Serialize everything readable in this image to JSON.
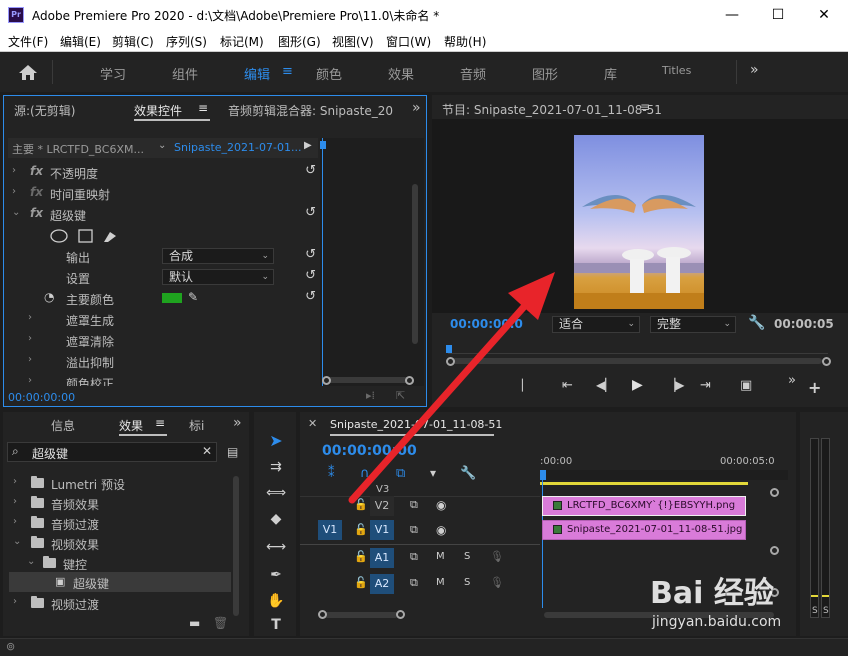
{
  "window": {
    "logo": "Pr",
    "title": "Adobe Premiere Pro 2020 - d:\\文档\\Adobe\\Premiere Pro\\11.0\\未命名 *",
    "minimize": "—",
    "maximize": "☐",
    "close": "✕"
  },
  "menu": [
    "文件(F)",
    "编辑(E)",
    "剪辑(C)",
    "序列(S)",
    "标记(M)",
    "图形(G)",
    "视图(V)",
    "窗口(W)",
    "帮助(H)"
  ],
  "workspaces": {
    "items": [
      "学习",
      "组件",
      "编辑",
      "颜色",
      "效果",
      "音频",
      "图形",
      "库",
      "Titles"
    ],
    "active": "编辑",
    "more": "»"
  },
  "effect_controls": {
    "tabs": [
      "源:(无剪辑)",
      "效果控件",
      "音频剪辑混合器: Snipaste_20"
    ],
    "more": "»",
    "master": "主要 * LRCTFD_BC6XM...",
    "clip": "Snipaste_2021-07-01...",
    "rows": {
      "opacity": "不透明度",
      "time_remap": "时间重映射",
      "ultra_key": "超级键",
      "output": "输出",
      "output_value": "合成",
      "setting": "设置",
      "setting_value": "默认",
      "key_color": "主要颜色",
      "matte_gen": "遮罩生成",
      "matte_clean": "遮罩清除",
      "spill": "溢出抑制",
      "color_correct": "颜色校正"
    },
    "timecode": "00:00:00:00",
    "key_color_hex": "#1fa31f"
  },
  "program": {
    "title": "节目: Snipaste_2021-07-01_11-08-51",
    "timecode_left": "00:00:00:0",
    "fit": "适合",
    "quality": "完整",
    "timecode_right": "00:00:05",
    "plus": "+",
    "more": "»"
  },
  "effects_panel": {
    "tabs": [
      "信息",
      "效果",
      "标i"
    ],
    "more": "»",
    "search_value": "超级键",
    "items": {
      "lumetri": "Lumetri 预设",
      "audio_effects": "音频效果",
      "audio_transitions": "音频过渡",
      "video_effects": "视频效果",
      "keying": "键控",
      "ultra_key": "超级键",
      "video_transitions": "视频过渡"
    }
  },
  "timeline": {
    "tab": "Snipaste_2021-07-01_11-08-51",
    "timecode": "00:00:00:00",
    "ruler_start": ":00:00",
    "ruler_end": "00:00:05:0",
    "tracks": {
      "v3": "V3",
      "v2": "V2",
      "v1": "V1",
      "a1": "A1",
      "a2": "A2",
      "m": "M",
      "s": "S"
    },
    "clips": {
      "v2": "LRCTFD_BC6XMY`{!}EBSYYH.png",
      "v1": "Snipaste_2021-07-01_11-08-51.jpg"
    }
  },
  "meter": {
    "s1": "S",
    "s2": "S"
  },
  "watermark": {
    "main": "Bai 经验",
    "sub": "jingyan.baidu.com"
  }
}
